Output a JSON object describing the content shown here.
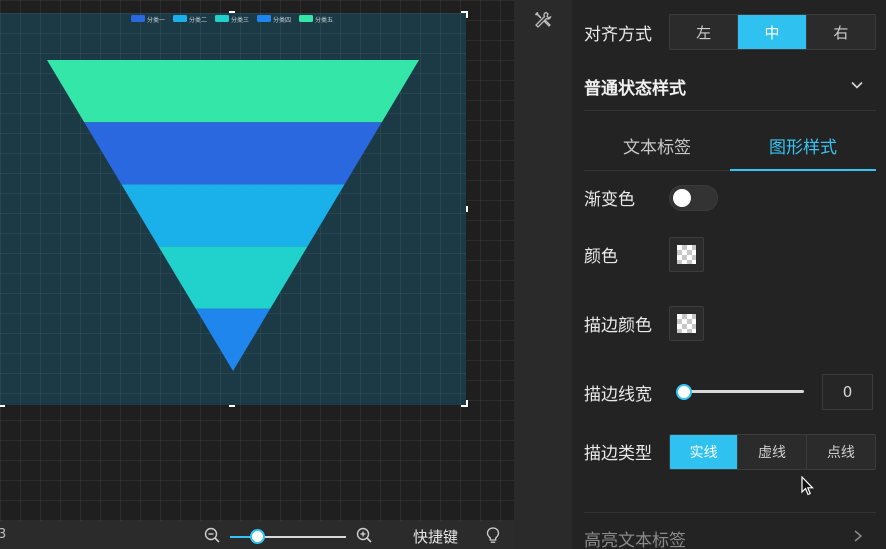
{
  "chart": {
    "legend": [
      "分类一",
      "分类二",
      "分类三",
      "分类四",
      "分类五"
    ],
    "colors": [
      "#34e6a8",
      "#2a68e0",
      "#1ab0ea",
      "#21d2cc",
      "#1f86ee"
    ],
    "background": "#1b3a46"
  },
  "chart_data": {
    "type": "funnel",
    "categories": [
      "分类一",
      "分类二",
      "分类三",
      "分类四",
      "分类五"
    ],
    "values": [
      100,
      80,
      60,
      40,
      20
    ]
  },
  "bottom_bar": {
    "zoom_text": "3",
    "zoom_fraction": 0.24,
    "shortcut_label": "快捷键"
  },
  "panel": {
    "align_label": "对齐方式",
    "align_options": [
      "左",
      "中",
      "右"
    ],
    "align_selected": "中",
    "section_title": "普通状态样式",
    "tabs": [
      "文本标签",
      "图形样式"
    ],
    "active_tab": "图形样式",
    "gradient_label": "渐变色",
    "gradient_enabled": false,
    "color_label": "颜色",
    "stroke_color_label": "描边颜色",
    "stroke_width_label": "描边线宽",
    "stroke_width_value": "0",
    "stroke_type_label": "描边类型",
    "stroke_types": [
      "实线",
      "虚线",
      "点线"
    ],
    "stroke_type_selected": "实线",
    "highlight_label": "高亮文本标签"
  },
  "accent_color": "#2fc1f0"
}
